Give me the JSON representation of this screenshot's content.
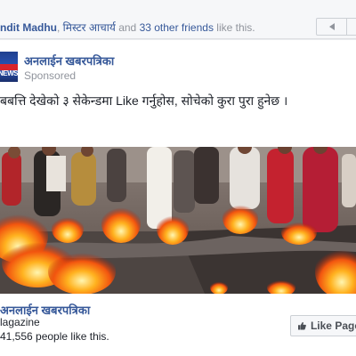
{
  "friends_line": {
    "name1": "ndit Madhu",
    "sep": ", ",
    "name2": "मिस्टर आचार्य",
    "and": " and ",
    "count": "33 other friends",
    "suffix": " like this."
  },
  "ad": {
    "page_name": "अनलाईन खबरपत्रिका",
    "sponsored": "Sponsored",
    "logo_text": "NEWS",
    "post_text": "बबत्ति देखेको ३ सेकेन्डमा Like गर्नुहोस, सोचेको कुरा पुरा हुनेछ ।"
  },
  "footer": {
    "page_name": "अनलाईन खबरपत्रिका",
    "category": "lagazine",
    "likes": "41,556 people like this.",
    "like_button": "Like Page"
  },
  "colors": {
    "link": "#365899",
    "muted": "#90949c",
    "text": "#1d2129",
    "background": "#e9ebee"
  },
  "icons": [
    "previous-arrow-icon",
    "thumbs-up-icon",
    "news-logo-icon"
  ]
}
